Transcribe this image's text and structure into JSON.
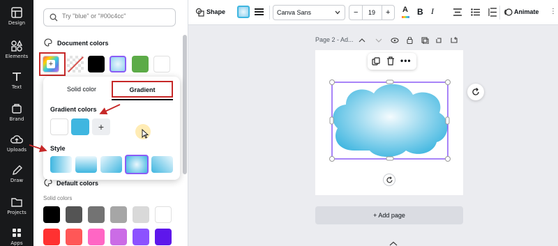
{
  "rail": {
    "items": [
      {
        "label": "Design"
      },
      {
        "label": "Elements"
      },
      {
        "label": "Text"
      },
      {
        "label": "Brand"
      },
      {
        "label": "Uploads"
      },
      {
        "label": "Draw"
      },
      {
        "label": "Projects"
      },
      {
        "label": "Apps"
      }
    ]
  },
  "panel": {
    "search_placeholder": "Try \"blue\" or \"#00c4cc\"",
    "document_colors_title": "Document colors",
    "default_colors_title": "Default colors",
    "solid_colors_title": "Solid colors",
    "document_swatch_colors": [
      "#000000",
      "#b7e3f5",
      "#5cab48",
      "#ffffff"
    ],
    "solid_row1": [
      "#000000",
      "#545454",
      "#737373",
      "#a6a6a6",
      "#d9d9d9",
      "#ffffff"
    ],
    "solid_row2": [
      "#ff3131",
      "#ff5757",
      "#ff66c4",
      "#cb6ce6",
      "#8c52ff",
      "#5e17eb"
    ]
  },
  "popover": {
    "tab_solid": "Solid color",
    "tab_gradient": "Gradient",
    "gradient_colors_title": "Gradient colors",
    "gradient_color_swatches": [
      "#ffffff",
      "#3fb6e0"
    ],
    "style_title": "Style",
    "add_symbol": "+"
  },
  "toolbar": {
    "shape_label": "Shape",
    "font_name": "Canva Sans",
    "font_size": "19",
    "minus": "−",
    "plus": "+",
    "bold": "B",
    "animate_label": "Animate"
  },
  "canvas": {
    "page_title": "Page 2 - Ad...",
    "add_page_label": "+ Add page"
  },
  "colors": {
    "accent_red": "#c62828",
    "selection_purple": "#8b5cf6",
    "cloud_blue": "#3fb6e0"
  }
}
